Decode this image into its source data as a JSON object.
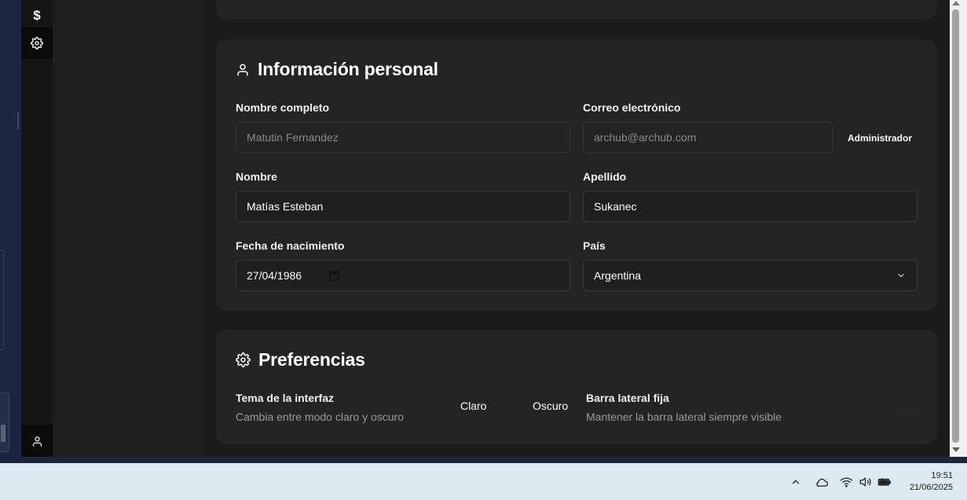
{
  "rail": {
    "dollar_glyph": "$"
  },
  "personal": {
    "title": "Información personal",
    "full_name_label": "Nombre completo",
    "full_name_value": "Matutin Fernandez",
    "email_label": "Correo electrónico",
    "email_value": "archub@archub.com",
    "role_badge": "Administrador",
    "first_name_label": "Nombre",
    "first_name_value": "Matías Esteban",
    "last_name_label": "Apellido",
    "last_name_value": "Sukanec",
    "birthdate_label": "Fecha de nacimiento",
    "birthdate_value": "27/04/1986",
    "country_label": "País",
    "country_value": "Argentina"
  },
  "preferences": {
    "title": "Preferencias",
    "theme_title": "Tema de la interfaz",
    "theme_desc": "Cambia entre modo claro y oscuro",
    "theme_options": [
      "Claro",
      "Oscuro"
    ],
    "sidebar_title": "Barra lateral fija",
    "sidebar_desc": "Mantener la barra lateral siempre visible"
  },
  "taskbar": {
    "time": "19:51",
    "date": "21/06/2025",
    "tray_icons": [
      "chevron-up-icon",
      "cloud-icon",
      "wifi-icon",
      "volume-icon",
      "battery-icon"
    ]
  }
}
